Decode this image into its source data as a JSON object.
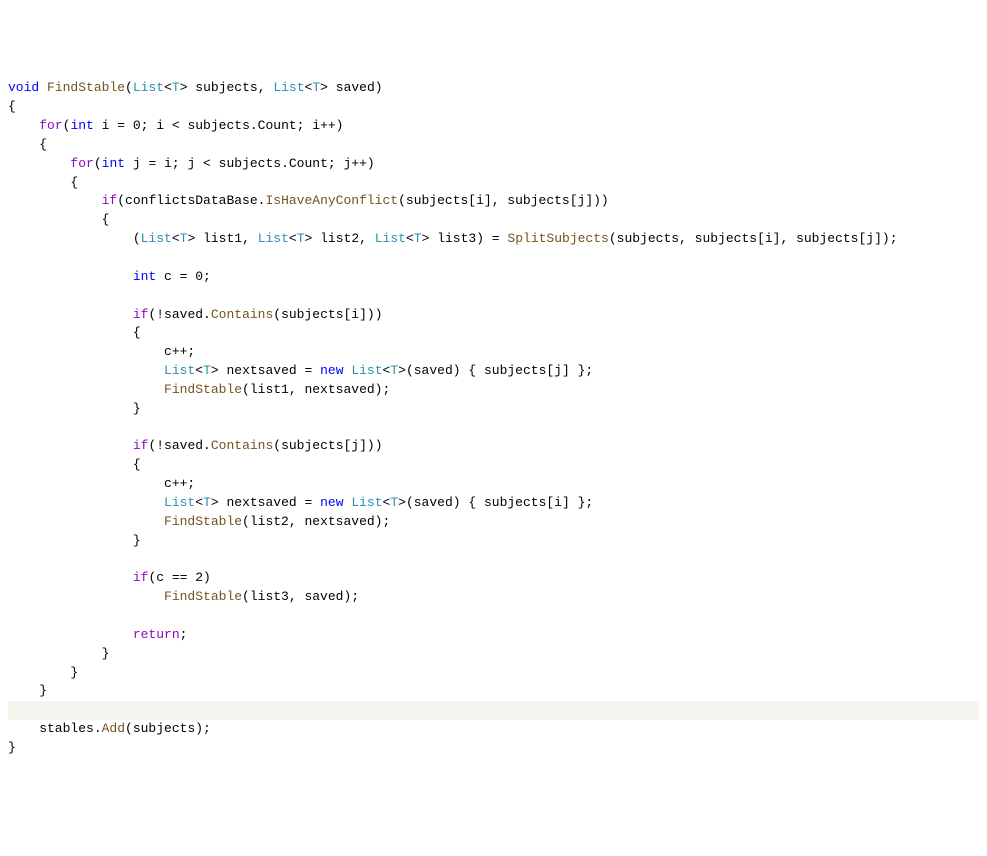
{
  "code": {
    "tokens": [
      [
        {
          "t": "kw",
          "v": "void"
        },
        {
          "t": "plain",
          "v": " "
        },
        {
          "t": "method",
          "v": "FindStable"
        },
        {
          "t": "plain",
          "v": "("
        },
        {
          "t": "type",
          "v": "List"
        },
        {
          "t": "plain",
          "v": "<"
        },
        {
          "t": "type",
          "v": "T"
        },
        {
          "t": "plain",
          "v": "> subjects, "
        },
        {
          "t": "type",
          "v": "List"
        },
        {
          "t": "plain",
          "v": "<"
        },
        {
          "t": "type",
          "v": "T"
        },
        {
          "t": "plain",
          "v": "> saved)"
        }
      ],
      [
        {
          "t": "plain",
          "v": "{"
        }
      ],
      [
        {
          "t": "plain",
          "v": "    "
        },
        {
          "t": "ctrl",
          "v": "for"
        },
        {
          "t": "plain",
          "v": "("
        },
        {
          "t": "kw",
          "v": "int"
        },
        {
          "t": "plain",
          "v": " i = 0; i < subjects.Count; i++)"
        }
      ],
      [
        {
          "t": "plain",
          "v": "    {"
        }
      ],
      [
        {
          "t": "plain",
          "v": "        "
        },
        {
          "t": "ctrl",
          "v": "for"
        },
        {
          "t": "plain",
          "v": "("
        },
        {
          "t": "kw",
          "v": "int"
        },
        {
          "t": "plain",
          "v": " j = i; j < subjects.Count; j++)"
        }
      ],
      [
        {
          "t": "plain",
          "v": "        {"
        }
      ],
      [
        {
          "t": "plain",
          "v": "            "
        },
        {
          "t": "ctrl",
          "v": "if"
        },
        {
          "t": "plain",
          "v": "(conflictsDataBase."
        },
        {
          "t": "method",
          "v": "IsHaveAnyConflict"
        },
        {
          "t": "plain",
          "v": "(subjects[i], subjects[j]))"
        }
      ],
      [
        {
          "t": "plain",
          "v": "            {"
        }
      ],
      [
        {
          "t": "plain",
          "v": "                ("
        },
        {
          "t": "type",
          "v": "List"
        },
        {
          "t": "plain",
          "v": "<"
        },
        {
          "t": "type",
          "v": "T"
        },
        {
          "t": "plain",
          "v": "> list1, "
        },
        {
          "t": "type",
          "v": "List"
        },
        {
          "t": "plain",
          "v": "<"
        },
        {
          "t": "type",
          "v": "T"
        },
        {
          "t": "plain",
          "v": "> list2, "
        },
        {
          "t": "type",
          "v": "List"
        },
        {
          "t": "plain",
          "v": "<"
        },
        {
          "t": "type",
          "v": "T"
        },
        {
          "t": "plain",
          "v": "> list3) = "
        },
        {
          "t": "method",
          "v": "SplitSubjects"
        },
        {
          "t": "plain",
          "v": "(subjects, subjects[i], subjects[j]);"
        }
      ],
      [
        {
          "t": "plain",
          "v": ""
        }
      ],
      [
        {
          "t": "plain",
          "v": "                "
        },
        {
          "t": "kw",
          "v": "int"
        },
        {
          "t": "plain",
          "v": " c = 0;"
        }
      ],
      [
        {
          "t": "plain",
          "v": ""
        }
      ],
      [
        {
          "t": "plain",
          "v": "                "
        },
        {
          "t": "ctrl",
          "v": "if"
        },
        {
          "t": "plain",
          "v": "(!saved."
        },
        {
          "t": "method",
          "v": "Contains"
        },
        {
          "t": "plain",
          "v": "(subjects[i]))"
        }
      ],
      [
        {
          "t": "plain",
          "v": "                {"
        }
      ],
      [
        {
          "t": "plain",
          "v": "                    c++;"
        }
      ],
      [
        {
          "t": "plain",
          "v": "                    "
        },
        {
          "t": "type",
          "v": "List"
        },
        {
          "t": "plain",
          "v": "<"
        },
        {
          "t": "type",
          "v": "T"
        },
        {
          "t": "plain",
          "v": "> nextsaved = "
        },
        {
          "t": "kw",
          "v": "new"
        },
        {
          "t": "plain",
          "v": " "
        },
        {
          "t": "type",
          "v": "List"
        },
        {
          "t": "plain",
          "v": "<"
        },
        {
          "t": "type",
          "v": "T"
        },
        {
          "t": "plain",
          "v": ">(saved) { subjects[j] };"
        }
      ],
      [
        {
          "t": "plain",
          "v": "                    "
        },
        {
          "t": "method",
          "v": "FindStable"
        },
        {
          "t": "plain",
          "v": "(list1, nextsaved);"
        }
      ],
      [
        {
          "t": "plain",
          "v": "                }"
        }
      ],
      [
        {
          "t": "plain",
          "v": ""
        }
      ],
      [
        {
          "t": "plain",
          "v": "                "
        },
        {
          "t": "ctrl",
          "v": "if"
        },
        {
          "t": "plain",
          "v": "(!saved."
        },
        {
          "t": "method",
          "v": "Contains"
        },
        {
          "t": "plain",
          "v": "(subjects[j]))"
        }
      ],
      [
        {
          "t": "plain",
          "v": "                {"
        }
      ],
      [
        {
          "t": "plain",
          "v": "                    c++;"
        }
      ],
      [
        {
          "t": "plain",
          "v": "                    "
        },
        {
          "t": "type",
          "v": "List"
        },
        {
          "t": "plain",
          "v": "<"
        },
        {
          "t": "type",
          "v": "T"
        },
        {
          "t": "plain",
          "v": "> nextsaved = "
        },
        {
          "t": "kw",
          "v": "new"
        },
        {
          "t": "plain",
          "v": " "
        },
        {
          "t": "type",
          "v": "List"
        },
        {
          "t": "plain",
          "v": "<"
        },
        {
          "t": "type",
          "v": "T"
        },
        {
          "t": "plain",
          "v": ">(saved) { subjects[i] };"
        }
      ],
      [
        {
          "t": "plain",
          "v": "                    "
        },
        {
          "t": "method",
          "v": "FindStable"
        },
        {
          "t": "plain",
          "v": "(list2, nextsaved);"
        }
      ],
      [
        {
          "t": "plain",
          "v": "                }"
        }
      ],
      [
        {
          "t": "plain",
          "v": ""
        }
      ],
      [
        {
          "t": "plain",
          "v": "                "
        },
        {
          "t": "ctrl",
          "v": "if"
        },
        {
          "t": "plain",
          "v": "(c == 2)"
        }
      ],
      [
        {
          "t": "plain",
          "v": "                    "
        },
        {
          "t": "method",
          "v": "FindStable"
        },
        {
          "t": "plain",
          "v": "(list3, saved);"
        }
      ],
      [
        {
          "t": "plain",
          "v": ""
        }
      ],
      [
        {
          "t": "plain",
          "v": "                "
        },
        {
          "t": "ctrl",
          "v": "return"
        },
        {
          "t": "plain",
          "v": ";"
        }
      ],
      [
        {
          "t": "plain",
          "v": "            }"
        }
      ],
      [
        {
          "t": "plain",
          "v": "        }"
        }
      ],
      [
        {
          "t": "plain",
          "v": "    }"
        }
      ],
      [
        {
          "t": "plain",
          "v": ""
        }
      ],
      [
        {
          "t": "plain",
          "v": "    stables."
        },
        {
          "t": "method",
          "v": "Add"
        },
        {
          "t": "plain",
          "v": "(subjects);"
        }
      ],
      [
        {
          "t": "plain",
          "v": "}"
        }
      ]
    ],
    "highlighted_line_index": 33
  }
}
